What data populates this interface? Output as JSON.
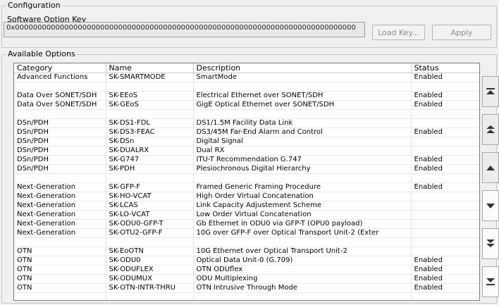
{
  "configuration": {
    "title": "Configuration",
    "key_label": "Software Option Key",
    "key_value": "0x0000000000000000000000000000000000000000000000000000000000000000000000000000",
    "load_key_label": "Load Key...",
    "apply_label": "Apply"
  },
  "options": {
    "title": "Available Options",
    "columns": [
      "Category",
      "Name",
      "Description",
      "Status"
    ],
    "rows": [
      [
        "Advanced Functions",
        "SK-SMARTMODE",
        "SmartMode",
        "Enabled"
      ],
      [
        "",
        "",
        "",
        ""
      ],
      [
        "Data Over SONET/SDH",
        "SK-EEoS",
        "Electrical Ethernet over SONET/SDH",
        "Enabled"
      ],
      [
        "Data Over SONET/SDH",
        "SK-GEoS",
        "GigE Optical Ethernet over SONET/SDH",
        "Enabled"
      ],
      [
        "",
        "",
        "",
        ""
      ],
      [
        "DSn/PDH",
        "SK-DS1-FDL",
        "DS1/1.5M Facility Data Link",
        ""
      ],
      [
        "DSn/PDH",
        "SK-DS3-FEAC",
        "DS3/45M Far-End Alarm and Control",
        "Enabled"
      ],
      [
        "DSn/PDH",
        "SK-DSn",
        "Digital Signal",
        ""
      ],
      [
        "DSn/PDH",
        "SK-DUALRX",
        "Dual RX",
        ""
      ],
      [
        "DSn/PDH",
        "SK-G747",
        "ITU-T Recommendation G.747",
        "Enabled"
      ],
      [
        "DSn/PDH",
        "SK-PDH",
        "Plesiochronous Digital Hierarchy",
        "Enabled"
      ],
      [
        "",
        "",
        "",
        ""
      ],
      [
        "Next-Generation",
        "SK-GFP-F",
        "Framed Generic Framing Procedure",
        "Enabled"
      ],
      [
        "Next-Generation",
        "SK-HO-VCAT",
        "High Order Virtual Concatenation",
        ""
      ],
      [
        "Next-Generation",
        "SK-LCAS",
        "Link Capacity Adjustement Scheme",
        ""
      ],
      [
        "Next-Generation",
        "SK-LO-VCAT",
        "Low Order Virtual Concatenation",
        ""
      ],
      [
        "Next-Generation",
        "SK-ODU0-GFP-T",
        "Gb Ethernet in ODU0 via GFP-T (OPU0 payload)",
        ""
      ],
      [
        "Next-Generation",
        "SK-OTU2-GFP-F",
        "10G over GFP-F over Optical Transport Unit-2 (Exter",
        ""
      ],
      [
        "",
        "",
        "",
        ""
      ],
      [
        "OTN",
        "SK-EoOTN",
        "10G Ethernet over Optical Transport Unit-2",
        ""
      ],
      [
        "OTN",
        "SK-ODU0",
        "Optical Data Unit-0 (G.709)",
        "Enabled"
      ],
      [
        "OTN",
        "SK-ODUFLEX",
        "OTN ODUflex",
        "Enabled"
      ],
      [
        "OTN",
        "SK-ODUMUX",
        "ODU Multiplexing",
        "Enabled"
      ],
      [
        "OTN",
        "SK-OTN-INTR-THRU",
        "OTN Intrusive Through Mode",
        "Enabled"
      ],
      [
        "",
        "",
        "",
        ""
      ],
      [
        "",
        "",
        "",
        ""
      ]
    ]
  },
  "scroll_buttons": [
    {
      "name": "scroll-top-icon",
      "bright": false
    },
    {
      "name": "page-up-icon",
      "bright": false
    },
    {
      "name": "scroll-up-icon",
      "bright": false
    },
    {
      "name": "scroll-down-icon",
      "bright": true
    },
    {
      "name": "page-down-icon",
      "bright": true
    },
    {
      "name": "scroll-bottom-icon",
      "bright": true
    }
  ]
}
